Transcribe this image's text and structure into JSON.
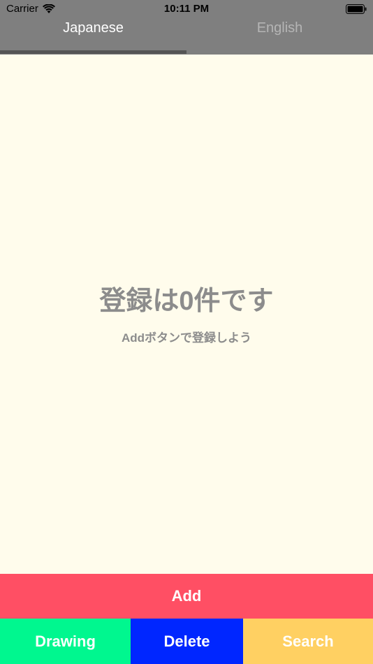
{
  "status_bar": {
    "carrier": "Carrier",
    "time": "10:11 PM"
  },
  "tabs": [
    {
      "label": "Japanese",
      "active": true
    },
    {
      "label": "English",
      "active": false
    }
  ],
  "empty_state": {
    "title": "登録は0件です",
    "subtitle": "Addボタンで登録しよう"
  },
  "buttons": {
    "add": {
      "label": "Add",
      "color": "#ff4f64"
    },
    "drawing": {
      "label": "Drawing",
      "color": "#00f78f"
    },
    "delete": {
      "label": "Delete",
      "color": "#0026ff"
    },
    "search": {
      "label": "Search",
      "color": "#ffd062"
    }
  },
  "colors": {
    "header": "#7f7f7f",
    "background": "#fffcec",
    "tab_indicator": "#555555"
  },
  "icons": [
    "wifi-icon",
    "battery-icon"
  ]
}
